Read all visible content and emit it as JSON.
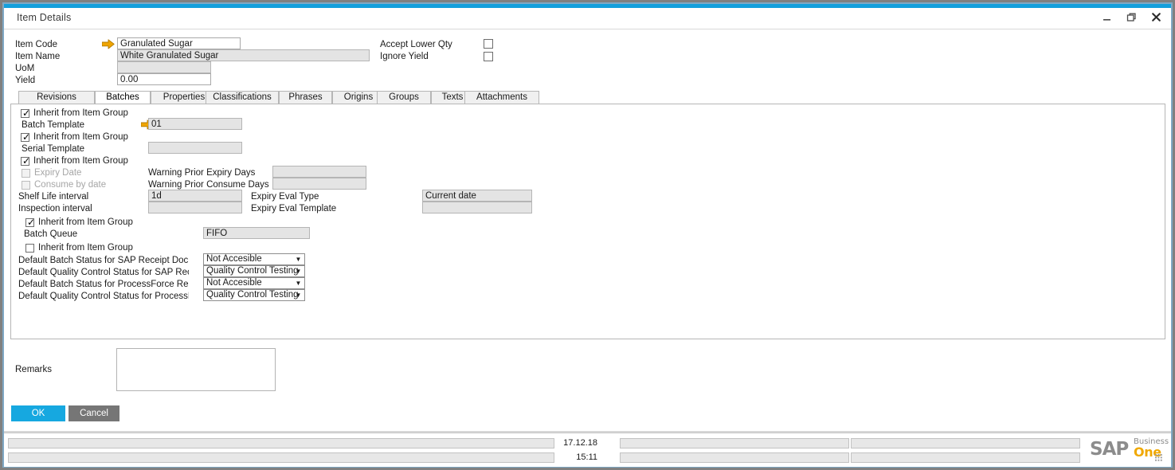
{
  "window": {
    "title": "Item Details",
    "controls": [
      {
        "name": "minimize-button",
        "glyph": "minimize"
      },
      {
        "name": "restore-button",
        "glyph": "restore"
      },
      {
        "name": "close-button",
        "glyph": "close"
      }
    ],
    "accent_color": "#14a0dc"
  },
  "header": {
    "fields": [
      {
        "label": "Item Code",
        "value": "Granulated Sugar",
        "readonly": false,
        "has_arrow": true
      },
      {
        "label": "Item Name",
        "value": "White Granulated Sugar",
        "readonly": true,
        "has_arrow": false
      },
      {
        "label": "UoM",
        "value": "",
        "readonly": true,
        "has_arrow": false
      },
      {
        "label": "Yield",
        "value": "0.00",
        "readonly": false,
        "has_arrow": false
      }
    ],
    "checkboxes": [
      {
        "label": "Accept Lower Qty",
        "checked": false
      },
      {
        "label": "Ignore Yield",
        "checked": false
      }
    ]
  },
  "tabs": {
    "active": "Batches",
    "items": [
      {
        "label": "Revisions"
      },
      {
        "label": "Batches"
      },
      {
        "label": "Properties"
      },
      {
        "label": "Classifications"
      },
      {
        "label": "Phrases"
      },
      {
        "label": "Origins"
      },
      {
        "label": "Groups"
      },
      {
        "label": "Texts"
      },
      {
        "label": "Attachments"
      }
    ]
  },
  "batches": {
    "inherit_label": "Inherit from Item Group",
    "inherit_batch_template": true,
    "batch_template_label": "Batch Template",
    "batch_template_value": "01",
    "inherit_serial_template": true,
    "serial_template_label": "Serial Template",
    "serial_template_value": "",
    "inherit_expiry": true,
    "expiry_date_label": "Expiry Date",
    "expiry_date_checked": false,
    "consume_by_date_label": "Consume by date",
    "consume_by_date_checked": false,
    "warning_prior_expiry_label": "Warning Prior Expiry Days",
    "warning_prior_expiry_value": "",
    "warning_prior_consume_label": "Warning Prior Consume Days",
    "warning_prior_consume_value": "",
    "shelf_life_label": "Shelf Life interval",
    "shelf_life_value": "1d",
    "inspection_label": "Inspection interval",
    "inspection_value": "",
    "expiry_eval_type_label": "Expiry Eval Type",
    "expiry_eval_type_value": "Current date",
    "expiry_eval_template_label": "Expiry Eval Template",
    "expiry_eval_template_value": "",
    "inherit_batch_queue": true,
    "batch_queue_label": "Batch Queue",
    "batch_queue_value": "FIFO",
    "inherit_statuses": false,
    "status_rows": [
      {
        "label": "Default Batch Status for SAP Receipt Docum",
        "value": "Not Accesible"
      },
      {
        "label": "Default Quality Control Status for SAP Recei",
        "value": "Quality Control Testing"
      },
      {
        "label": "Default Batch Status for ProcessForce Receip",
        "value": "Not Accesible"
      },
      {
        "label": "Default Quality Control Status for ProcessFo",
        "value": "Quality Control Testing"
      }
    ]
  },
  "footer": {
    "remarks_label": "Remarks",
    "remarks_value": "",
    "ok_label": "OK",
    "cancel_label": "Cancel"
  },
  "statusbar": {
    "message_left": "",
    "message_left2": "",
    "date": "17.12.18",
    "time": "15:11",
    "field_mid_top": "",
    "field_mid_bottom": "",
    "field_right_top": "",
    "field_right_bottom": "",
    "brand_sap": "SAP",
    "brand_business": "Business",
    "brand_one": "One"
  }
}
